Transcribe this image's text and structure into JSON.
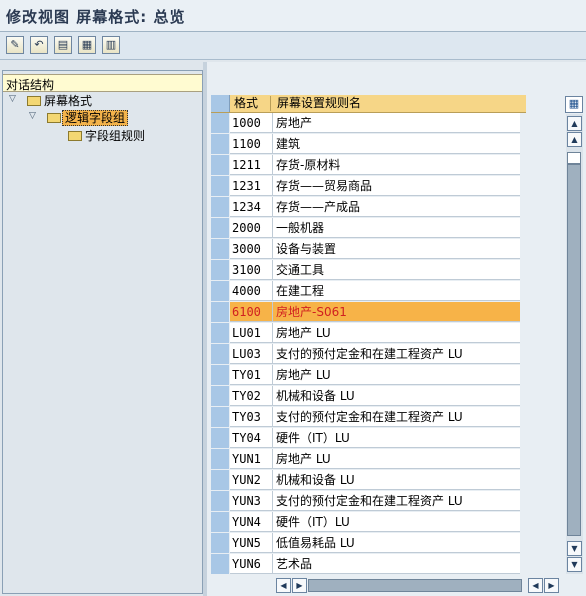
{
  "title": "修改视图 屏幕格式: 总览",
  "toolbar": {
    "buttons": [
      {
        "name": "edit-toggle-icon",
        "glyph": "✎"
      },
      {
        "name": "undo-icon",
        "glyph": "↶"
      },
      {
        "name": "table-view-icon",
        "glyph": "▤"
      },
      {
        "name": "export-icon",
        "glyph": "▦"
      },
      {
        "name": "details-icon",
        "glyph": "▥"
      }
    ]
  },
  "tree": {
    "header": "对话结构",
    "nodes": [
      {
        "label": "屏幕格式",
        "level": 0,
        "expanded": true,
        "selected": false
      },
      {
        "label": "逻辑字段组",
        "level": 1,
        "expanded": true,
        "selected": true
      },
      {
        "label": "字段组规则",
        "level": 2,
        "expanded": false,
        "selected": false
      }
    ]
  },
  "table": {
    "columns": [
      "格式",
      "屏幕设置规则名"
    ],
    "rows": [
      {
        "code": "1000",
        "name": "房地产",
        "highlighted": false
      },
      {
        "code": "1100",
        "name": "建筑",
        "highlighted": false
      },
      {
        "code": "1211",
        "name": "存货-原材料",
        "highlighted": false
      },
      {
        "code": "1231",
        "name": "存货——贸易商品",
        "highlighted": false
      },
      {
        "code": "1234",
        "name": "存货——产成品",
        "highlighted": false
      },
      {
        "code": "2000",
        "name": "一般机器",
        "highlighted": false
      },
      {
        "code": "3000",
        "name": "设备与装置",
        "highlighted": false
      },
      {
        "code": "3100",
        "name": "交通工具",
        "highlighted": false
      },
      {
        "code": "4000",
        "name": "在建工程",
        "highlighted": false
      },
      {
        "code": "6100",
        "name": "房地产-S061",
        "highlighted": true
      },
      {
        "code": "LU01",
        "name": "房地产 LU",
        "highlighted": false
      },
      {
        "code": "LU03",
        "name": "支付的预付定金和在建工程资产 LU",
        "highlighted": false
      },
      {
        "code": "TY01",
        "name": "房地产 LU",
        "highlighted": false
      },
      {
        "code": "TY02",
        "name": "机械和设备 LU",
        "highlighted": false
      },
      {
        "code": "TY03",
        "name": "支付的预付定金和在建工程资产 LU",
        "highlighted": false
      },
      {
        "code": "TY04",
        "name": "硬件（IT）LU",
        "highlighted": false
      },
      {
        "code": "YUN1",
        "name": "房地产 LU",
        "highlighted": false
      },
      {
        "code": "YUN2",
        "name": "机械和设备 LU",
        "highlighted": false
      },
      {
        "code": "YUN3",
        "name": "支付的预付定金和在建工程资产 LU",
        "highlighted": false
      },
      {
        "code": "YUN4",
        "name": "硬件（IT）LU",
        "highlighted": false
      },
      {
        "code": "YUN5",
        "name": "低值易耗品 LU",
        "highlighted": false
      },
      {
        "code": "YUN6",
        "name": "艺术品",
        "highlighted": false
      }
    ]
  },
  "colors": {
    "highlight_row": "#f7b348",
    "highlight_text": "#d12020",
    "header_bg": "#f6d687"
  }
}
